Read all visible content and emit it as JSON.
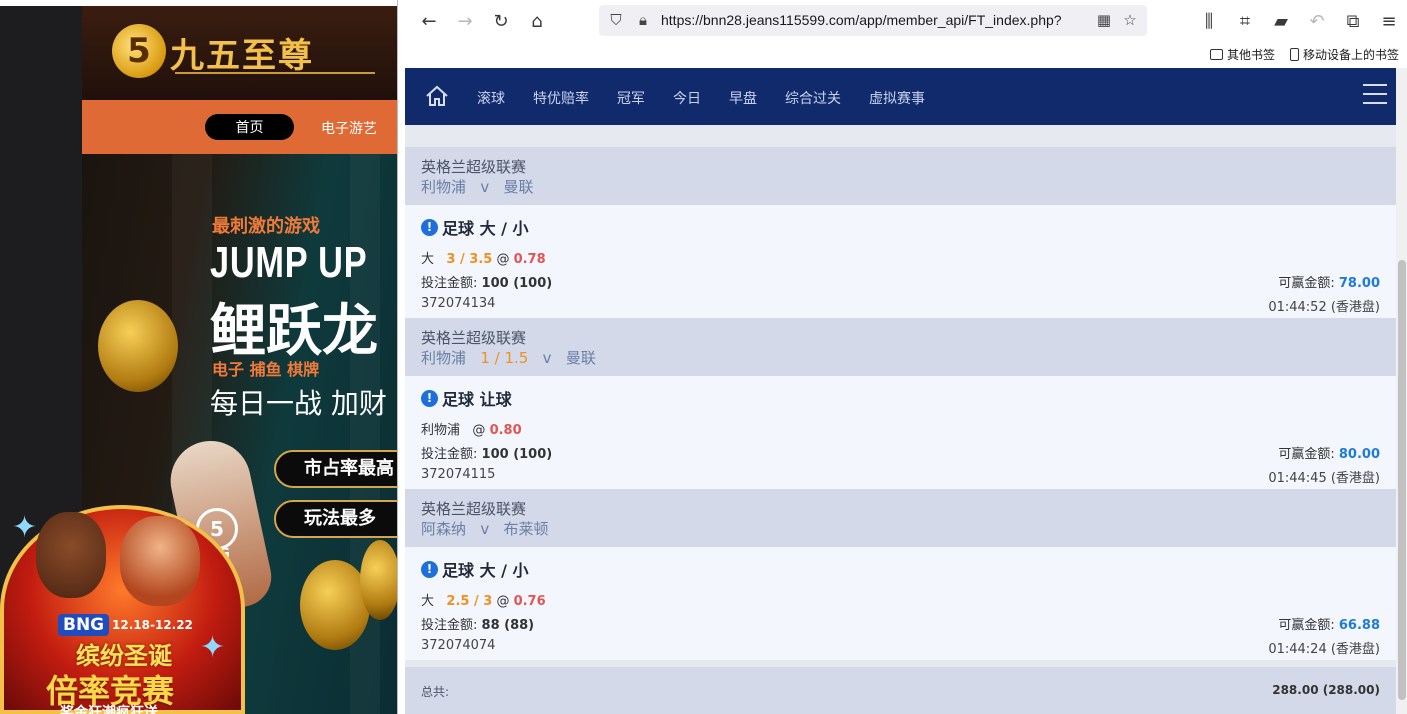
{
  "left_site": {
    "logo_text": "九五至尊",
    "logo_badge": "5",
    "nav_home": "首页",
    "nav_games": "电子游艺",
    "banner_tag": "最刺激的游戏",
    "banner_title_en": "JUMP UP",
    "banner_title_cn": "鲤跃龙",
    "banner_categories": "电子  捕鱼  棋牌",
    "banner_slogan": "每日一战  加财",
    "pill_1": "市占率最高",
    "pill_2": "玩法最多",
    "bng_badge": "5",
    "bng_label": "BNG",
    "promo_brand": "BNG",
    "promo_date": "12.18-12.22",
    "promo_line1": "缤纷圣诞",
    "promo_line2": "倍率竞赛",
    "promo_line3": "奖金狂潮疯狂送"
  },
  "browser": {
    "url": "https://bnn28.jeans115599.com/app/member_api/FT_index.php?",
    "bookmarks": [
      "其他书签",
      "移动设备上的书签"
    ]
  },
  "nav": {
    "items": [
      "滚球",
      "特优赔率",
      "冠军",
      "今日",
      "早盘",
      "综合过关",
      "虚拟赛事"
    ]
  },
  "bets": [
    {
      "league": "英格兰超级联赛",
      "home": "利物浦",
      "handicap": "",
      "vs": "v",
      "away": "曼联",
      "bet_type": "足球 大 / 小",
      "selection": "大",
      "line": "3 / 3.5",
      "at": "@",
      "odds": "0.78",
      "amount_label": "投注金额:",
      "amount": "100 (100)",
      "win_label": "可赢金额:",
      "win": "78.00",
      "ticket": "372074134",
      "time": "01:44:52 (香港盘)"
    },
    {
      "league": "英格兰超级联赛",
      "home": "利物浦",
      "handicap": "1 / 1.5",
      "vs": "v",
      "away": "曼联",
      "bet_type": "足球 让球",
      "selection": "利物浦",
      "line": "",
      "at": "@",
      "odds": "0.80",
      "amount_label": "投注金额:",
      "amount": "100 (100)",
      "win_label": "可赢金额:",
      "win": "80.00",
      "ticket": "372074115",
      "time": "01:44:45 (香港盘)"
    },
    {
      "league": "英格兰超级联赛",
      "home": "阿森纳",
      "handicap": "",
      "vs": "v",
      "away": "布莱顿",
      "bet_type": "足球 大 / 小",
      "selection": "大",
      "line": "2.5 / 3",
      "at": "@",
      "odds": "0.76",
      "amount_label": "投注金额:",
      "amount": "88 (88)",
      "win_label": "可赢金额:",
      "win": "66.88",
      "ticket": "372074074",
      "time": "01:44:24 (香港盘)"
    }
  ],
  "total": {
    "label": "总共:",
    "value": "288.00 (288.00)"
  },
  "colors": {
    "navbar": "#102a6b",
    "league_row": "#d3d9e8",
    "detail_row": "#f3f6fd",
    "handicap": "#f0901e",
    "odds": "#e25555",
    "win": "#1f7ad8"
  }
}
